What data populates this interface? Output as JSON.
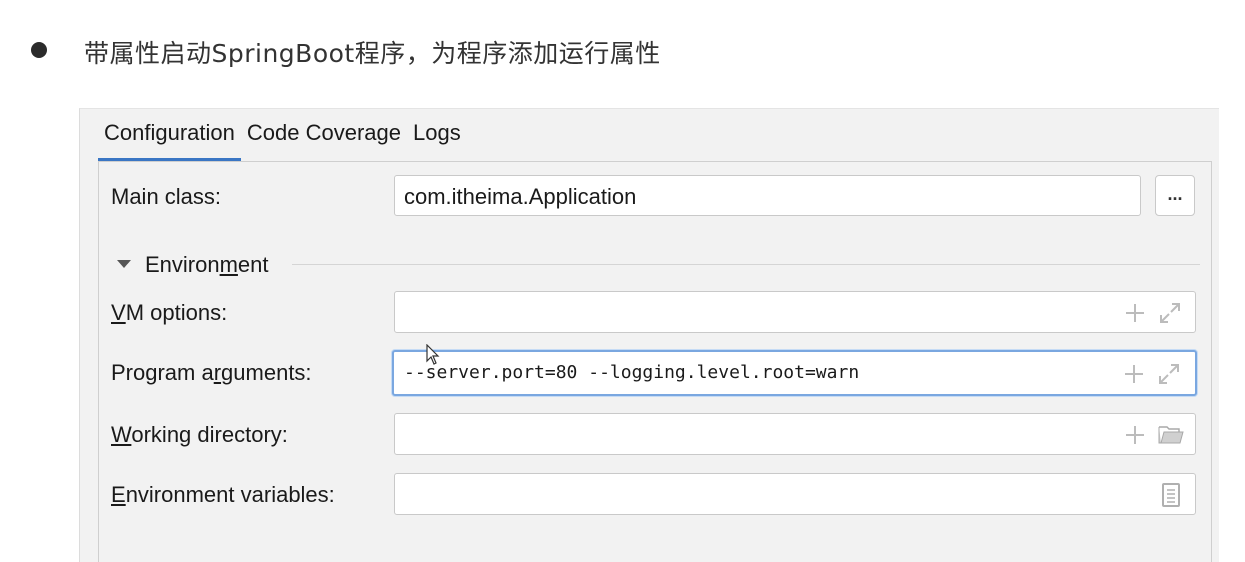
{
  "heading": {
    "text": "带属性启动SpringBoot程序，为程序添加运行属性"
  },
  "tabs": [
    {
      "label": "Configuration",
      "active": true
    },
    {
      "label": "Code Coverage",
      "active": false
    },
    {
      "label": "Logs",
      "active": false
    }
  ],
  "form": {
    "main_class": {
      "label": "Main class:",
      "value": "com.itheima.Application",
      "browse_label": "..."
    },
    "environment": {
      "label_pre": "Environ",
      "label_u": "m",
      "label_post": "ent",
      "expanded": true
    },
    "vm_options": {
      "label_u": "V",
      "label_rest": "M options:",
      "value": ""
    },
    "program_arguments": {
      "label_pre": "Program a",
      "label_u": "r",
      "label_post": "guments:",
      "value": "--server.port=80 --logging.level.root=warn"
    },
    "working_directory": {
      "label_u": "W",
      "label_rest": "orking directory:",
      "value": ""
    },
    "environment_variables": {
      "label_u": "E",
      "label_rest": "nvironment variables:",
      "value": ""
    }
  },
  "icons": {
    "add": "plus-icon",
    "expand": "expand-icon",
    "folder": "folder-icon",
    "document": "document-icon"
  },
  "colors": {
    "accent": "#3a76c4",
    "focus": "#7aa7e0",
    "panel_bg": "#f2f2f2"
  }
}
